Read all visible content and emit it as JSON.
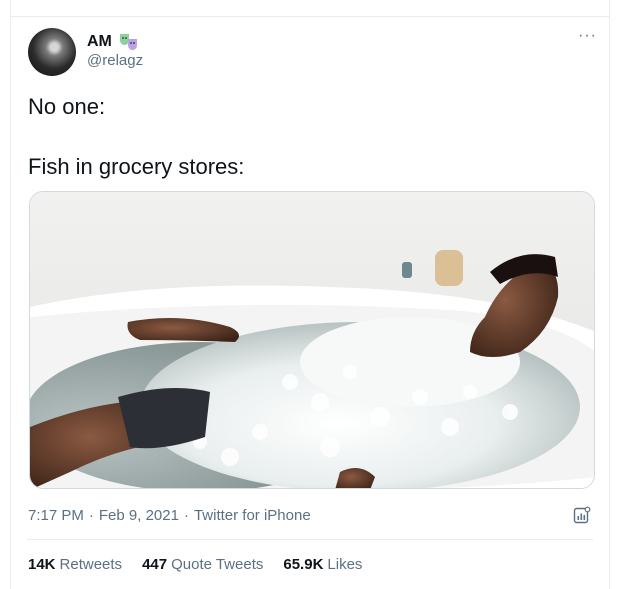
{
  "user": {
    "display_name": "AM",
    "handle": "@relagz",
    "badge_icon": "theater-masks-icon"
  },
  "tweet": {
    "line1": "No one:",
    "line2": "Fish in grocery stores:"
  },
  "meta": {
    "time": "7:17 PM",
    "date": "Feb 9, 2021",
    "source": "Twitter for iPhone",
    "separator": "·"
  },
  "stats": {
    "retweets_count": "14K",
    "retweets_label": "Retweets",
    "quotes_count": "447",
    "quotes_label": "Quote Tweets",
    "likes_count": "65.9K",
    "likes_label": "Likes"
  },
  "colors": {
    "text": "#0f1419",
    "secondary": "#5b7083",
    "border": "#e6ecf0"
  }
}
